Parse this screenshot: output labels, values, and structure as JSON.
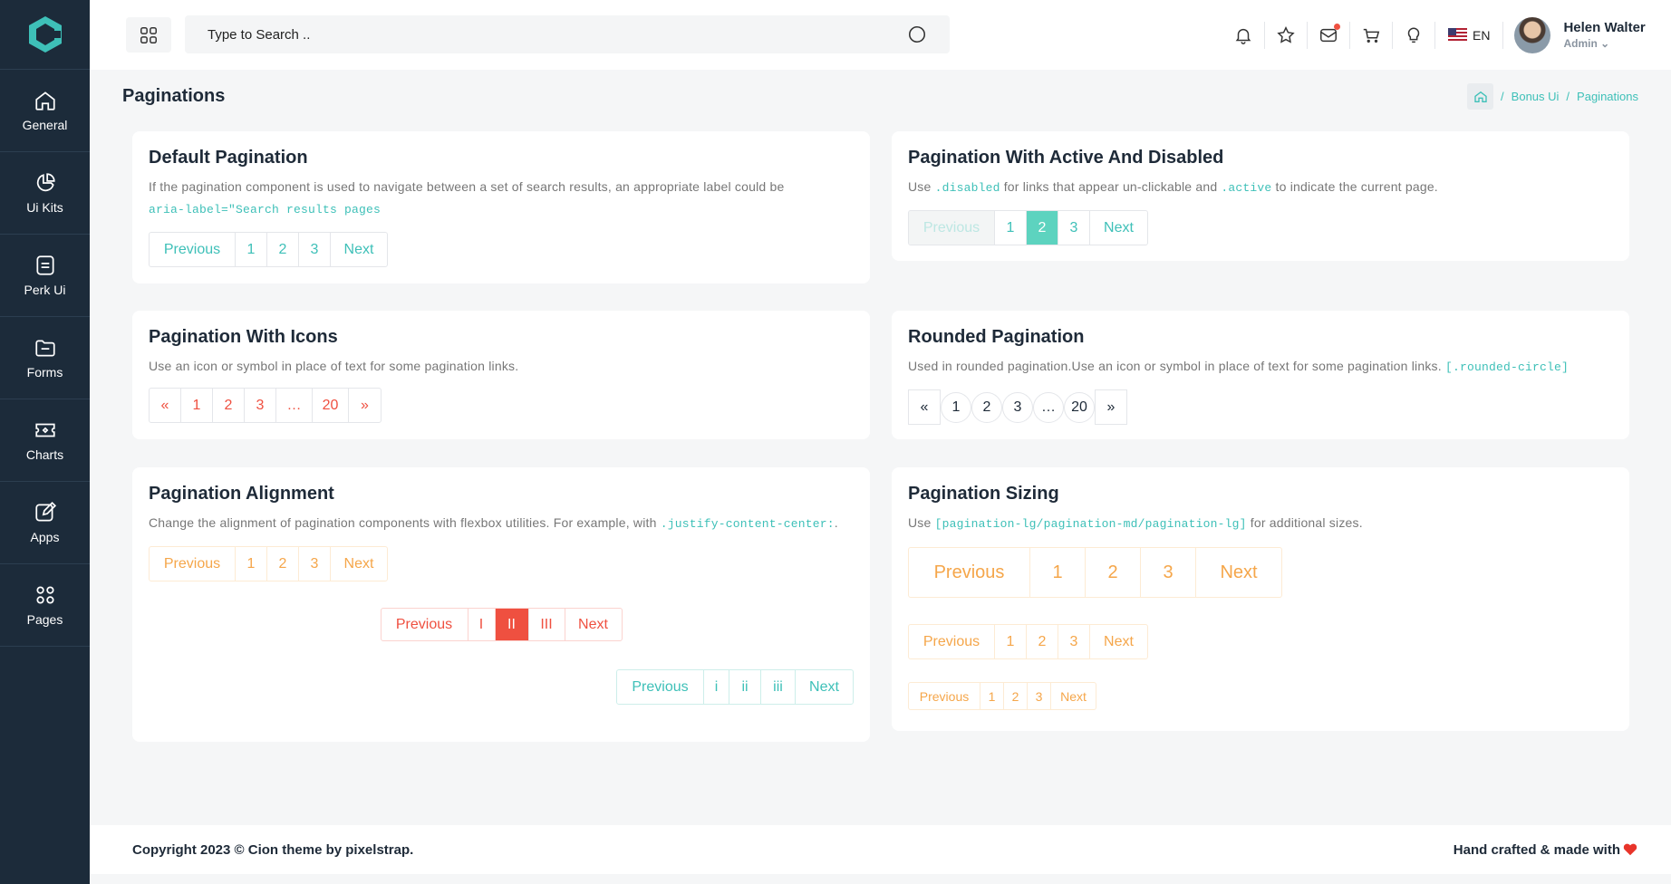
{
  "sidebar": {
    "items": [
      {
        "label": "General",
        "icon": "home-icon"
      },
      {
        "label": "Ui Kits",
        "icon": "pie-chart-icon"
      },
      {
        "label": "Perk Ui",
        "icon": "document-icon"
      },
      {
        "label": "Forms",
        "icon": "folder-icon"
      },
      {
        "label": "Charts",
        "icon": "ticket-icon"
      },
      {
        "label": "Apps",
        "icon": "edit-icon"
      },
      {
        "label": "Pages",
        "icon": "grid-icon"
      }
    ]
  },
  "header": {
    "search_placeholder": "Type to Search ..",
    "lang": "EN",
    "user_name": "Helen Walter",
    "user_role": "Admin"
  },
  "page": {
    "title": "Paginations",
    "breadcrumb": [
      "Bonus Ui",
      "Paginations"
    ]
  },
  "cards": {
    "default": {
      "title": "Default Pagination",
      "desc": "If the pagination component is used to navigate between a set of search results, an appropriate label could be",
      "code": "aria-label=\"Search results pages",
      "items": [
        "Previous",
        "1",
        "2",
        "3",
        "Next"
      ]
    },
    "active_disabled": {
      "title": "Pagination With Active And Disabled",
      "desc_pre": "Use",
      "code1": ".disabled",
      "desc_mid": "for links that appear un-clickable and",
      "code2": ".active",
      "desc_post": "to indicate the current page.",
      "items": [
        "Previous",
        "1",
        "2",
        "3",
        "Next"
      ]
    },
    "icons": {
      "title": "Pagination With Icons",
      "desc": "Use an icon or symbol in place of text for some pagination links.",
      "items": [
        "«",
        "1",
        "2",
        "3",
        "…",
        "20",
        "»"
      ]
    },
    "rounded": {
      "title": "Rounded Pagination",
      "desc": "Used in rounded pagination.Use an icon or symbol in place of text for some pagination links.",
      "code": "[.rounded-circle]",
      "items": [
        "«",
        "1",
        "2",
        "3",
        "…",
        "20",
        "»"
      ]
    },
    "alignment": {
      "title": "Pagination Alignment",
      "desc": "Change the alignment of pagination components with flexbox utilities. For example, with",
      "code": ".justify-content-center:",
      "desc_end": ".",
      "row1": [
        "Previous",
        "1",
        "2",
        "3",
        "Next"
      ],
      "row2": [
        "Previous",
        "I",
        "II",
        "III",
        "Next"
      ],
      "row3": [
        "Previous",
        "i",
        "ii",
        "iii",
        "Next"
      ]
    },
    "sizing": {
      "title": "Pagination Sizing",
      "desc_pre": "Use",
      "code": "[pagination-lg/pagination-md/pagination-lg]",
      "desc_post": "for additional sizes.",
      "lg": [
        "Previous",
        "1",
        "2",
        "3",
        "Next"
      ],
      "md": [
        "Previous",
        "1",
        "2",
        "3",
        "Next"
      ],
      "sm": [
        "Previous",
        "1",
        "2",
        "3",
        "Next"
      ]
    }
  },
  "footer": {
    "left": "Copyright 2023 © Cion theme by pixelstrap.",
    "right": "Hand crafted & made with"
  },
  "colors": {
    "teal": "#3ec0b8",
    "red": "#ef5040",
    "orange": "#f5a64a",
    "sidebar": "#1c2b3a"
  }
}
